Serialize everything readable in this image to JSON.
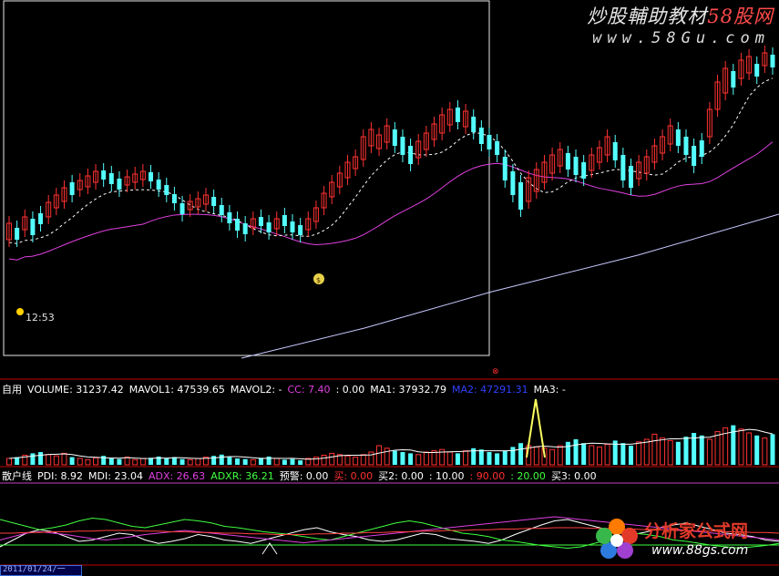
{
  "watermark": {
    "title_a": "炒股輔助教材",
    "title_b": "58股网",
    "url": "www.58Gu.com"
  },
  "logo": {
    "title": "分析家公式网",
    "url": "www.88gs.com"
  },
  "price_panel": {
    "time_label": "12:53",
    "bag_label": "$"
  },
  "volume_panel": {
    "items": [
      {
        "text": "自用",
        "color": "#ffffff"
      },
      {
        "text": "VOLUME: 31237.42",
        "color": "#ffffff"
      },
      {
        "text": "MAVOL1: 47539.65",
        "color": "#ffffff"
      },
      {
        "text": "MAVOL2: -",
        "color": "#ffffff"
      },
      {
        "text": "CC: 7.40",
        "color": "#e040e0"
      },
      {
        "text": ": 0.00",
        "color": "#ffffff"
      },
      {
        "text": "MA1: 37932.79",
        "color": "#ffffff"
      },
      {
        "text": "MA2: 47291.31",
        "color": "#3040ff"
      },
      {
        "text": "MA3: -",
        "color": "#ffffff"
      }
    ]
  },
  "indicator_panel": {
    "items": [
      {
        "text": "散户线",
        "color": "#ffffff"
      },
      {
        "text": "PDI: 8.92",
        "color": "#ffffff"
      },
      {
        "text": "MDI: 23.04",
        "color": "#ffffff"
      },
      {
        "text": "ADX: 26.63",
        "color": "#e040e0"
      },
      {
        "text": "ADXR: 36.21",
        "color": "#40ff40"
      },
      {
        "text": "预警: 0.00",
        "color": "#ffffff"
      },
      {
        "text": "买: 0.00",
        "color": "#ff3030"
      },
      {
        "text": "买2: 0.00",
        "color": "#ffffff"
      },
      {
        "text": ": 10.00",
        "color": "#ffffff"
      },
      {
        "text": ": 90.00",
        "color": "#ff3030"
      },
      {
        "text": ": 20.00",
        "color": "#40ff40"
      },
      {
        "text": "买3: 0.00",
        "color": "#ffffff"
      }
    ]
  },
  "date_label": "2011/01/24/一",
  "colors": {
    "up": "#ff3232",
    "down": "#54ffff",
    "ma_short": "#ffffff",
    "ma_mid": "#e040e0",
    "ma_long": "#c8c8ff",
    "spike": "#ffff60",
    "panel_border": "#c00000"
  },
  "chart_data": [
    {
      "type": "candlestick",
      "series": [
        {
          "name": "candles",
          "values": [
            [
              1,
              245,
              263
            ],
            [
              0,
              250,
              263
            ],
            [
              1,
              238,
              252
            ],
            [
              0,
              240,
              258
            ],
            [
              0,
              234,
              246
            ],
            [
              1,
              222,
              238
            ],
            [
              1,
              214,
              228
            ],
            [
              1,
              206,
              221
            ],
            [
              0,
              200,
              214
            ],
            [
              1,
              198,
              208
            ],
            [
              1,
              193,
              205
            ],
            [
              1,
              188,
              200
            ],
            [
              0,
              187,
              197
            ],
            [
              0,
              190,
              202
            ],
            [
              0,
              196,
              208
            ],
            [
              1,
              194,
              203
            ],
            [
              1,
              191,
              200
            ],
            [
              1,
              188,
              197
            ],
            [
              0,
              189,
              199
            ],
            [
              0,
              197,
              208
            ],
            [
              0,
              203,
              214
            ],
            [
              0,
              213,
              223
            ],
            [
              0,
              223,
              235
            ],
            [
              1,
              221,
              230
            ],
            [
              1,
              218,
              227
            ],
            [
              1,
              214,
              224
            ],
            [
              0,
              216,
              226
            ],
            [
              0,
              225,
              236
            ],
            [
              0,
              233,
              245
            ],
            [
              0,
              240,
              253
            ],
            [
              0,
              245,
              257
            ],
            [
              1,
              240,
              250
            ],
            [
              0,
              238,
              248
            ],
            [
              0,
              244,
              255
            ],
            [
              1,
              240,
              251
            ],
            [
              0,
              236,
              248
            ],
            [
              0,
              243,
              255
            ],
            [
              0,
              247,
              258
            ],
            [
              1,
              240,
              252
            ],
            [
              1,
              228,
              243
            ],
            [
              1,
              212,
              228
            ],
            [
              1,
              200,
              216
            ],
            [
              1,
              190,
              205
            ],
            [
              1,
              178,
              195
            ],
            [
              1,
              172,
              185
            ],
            [
              1,
              150,
              175
            ],
            [
              1,
              142,
              160
            ],
            [
              1,
              148,
              163
            ],
            [
              1,
              138,
              156
            ],
            [
              0,
              142,
              160
            ],
            [
              0,
              150,
              170
            ],
            [
              0,
              160,
              180
            ],
            [
              1,
              155,
              173
            ],
            [
              1,
              146,
              164
            ],
            [
              1,
              136,
              153
            ],
            [
              1,
              126,
              146
            ],
            [
              1,
              120,
              137
            ],
            [
              0,
              118,
              134
            ],
            [
              1,
              122,
              139
            ],
            [
              0,
              128,
              145
            ],
            [
              0,
              140,
              158
            ],
            [
              0,
              148,
              164
            ],
            [
              0,
              155,
              170
            ],
            [
              0,
              172,
              198
            ],
            [
              0,
              188,
              214
            ],
            [
              0,
              200,
              230
            ],
            [
              1,
              195,
              221
            ],
            [
              1,
              186,
              210
            ],
            [
              1,
              178,
              200
            ],
            [
              1,
              170,
              190
            ],
            [
              1,
              164,
              182
            ],
            [
              0,
              168,
              186
            ],
            [
              0,
              172,
              192
            ],
            [
              0,
              178,
              196
            ],
            [
              1,
              170,
              187
            ],
            [
              1,
              162,
              178
            ],
            [
              1,
              150,
              170
            ],
            [
              0,
              156,
              176
            ],
            [
              0,
              170,
              198
            ],
            [
              0,
              182,
              206
            ],
            [
              1,
              178,
              196
            ],
            [
              1,
              172,
              190
            ],
            [
              1,
              160,
              178
            ],
            [
              1,
              150,
              168
            ],
            [
              1,
              138,
              158
            ],
            [
              0,
              142,
              160
            ],
            [
              0,
              150,
              170
            ],
            [
              0,
              160,
              182
            ],
            [
              0,
              154,
              172
            ],
            [
              1,
              120,
              150
            ],
            [
              1,
              90,
              120
            ],
            [
              1,
              75,
              102
            ],
            [
              0,
              78,
              96
            ],
            [
              1,
              66,
              86
            ],
            [
              1,
              62,
              80
            ],
            [
              0,
              70,
              84
            ],
            [
              1,
              58,
              72
            ],
            [
              0,
              60,
              74
            ]
          ]
        }
      ],
      "ylim": [
        0,
        400
      ]
    },
    {
      "type": "bar",
      "series": [
        {
          "name": "VOLUME",
          "values": [
            10,
            12,
            15,
            18,
            20,
            16,
            14,
            18,
            12,
            10,
            8,
            11,
            14,
            10,
            9,
            12,
            8,
            10,
            11,
            13,
            10,
            12,
            9,
            8,
            10,
            12,
            14,
            16,
            12,
            10,
            9,
            8,
            11,
            13,
            10,
            8,
            9,
            7,
            10,
            12,
            15,
            18,
            16,
            14,
            12,
            16,
            20,
            30,
            26,
            22,
            20,
            18,
            16,
            20,
            22,
            24,
            20,
            18,
            22,
            26,
            24,
            20,
            18,
            22,
            28,
            34,
            30,
            28,
            26,
            24,
            30,
            36,
            40,
            34,
            30,
            28,
            32,
            38,
            34,
            30,
            36,
            40,
            48,
            42,
            38,
            36,
            44,
            50,
            46,
            40,
            52,
            58,
            62,
            56,
            50,
            46,
            42,
            48
          ]
        }
      ],
      "ylim": [
        0,
        100
      ]
    },
    {
      "type": "line",
      "series": [
        {
          "name": "PDI",
          "values": [
            20,
            30,
            40,
            45,
            42,
            35,
            28,
            30,
            35,
            40,
            38,
            30,
            25,
            28,
            32,
            38,
            35,
            30,
            28,
            25,
            30,
            35,
            40,
            45,
            48,
            42,
            38,
            35,
            30,
            28,
            30,
            35,
            40,
            38,
            32,
            30,
            28,
            25,
            30,
            38,
            45,
            52,
            58,
            60,
            55,
            50,
            45,
            40,
            38,
            42,
            48,
            52,
            55,
            50,
            45,
            40,
            38,
            35,
            30,
            28
          ]
        },
        {
          "name": "MDI",
          "values": [
            60,
            55,
            50,
            45,
            48,
            52,
            58,
            62,
            60,
            55,
            50,
            48,
            52,
            56,
            60,
            58,
            55,
            50,
            48,
            45,
            42,
            40,
            38,
            35,
            32,
            30,
            35,
            40,
            45,
            50,
            55,
            58,
            55,
            50,
            45,
            40,
            38,
            35,
            30,
            28,
            25,
            22,
            20,
            18,
            20,
            25,
            30,
            35,
            40,
            38,
            35,
            30,
            28,
            25,
            22,
            20,
            18,
            20,
            22,
            25
          ]
        },
        {
          "name": "ADX",
          "values": [
            30,
            35,
            40,
            42,
            40,
            38,
            35,
            32,
            30,
            32,
            35,
            38,
            40,
            42,
            44,
            42,
            40,
            38,
            36,
            34,
            32,
            30,
            28,
            26,
            28,
            30,
            32,
            34,
            36,
            38,
            40,
            42,
            44,
            46,
            48,
            50,
            52,
            54,
            56,
            58,
            60,
            62,
            64,
            62,
            60,
            58,
            56,
            54,
            52,
            50,
            48,
            46,
            44,
            42,
            40,
            38,
            36,
            34,
            32,
            30
          ]
        },
        {
          "name": "ADXR",
          "values": [
            40,
            40,
            41,
            41,
            42,
            42,
            43,
            43,
            44,
            44,
            44,
            43,
            43,
            42,
            42,
            41,
            41,
            40,
            40,
            39,
            39,
            38,
            38,
            38,
            39,
            39,
            40,
            40,
            41,
            41,
            42,
            42,
            43,
            43,
            44,
            44,
            45,
            45,
            46,
            46,
            47,
            47,
            48,
            48,
            48,
            47,
            47,
            46,
            46,
            45,
            45,
            44,
            44,
            43,
            43,
            42,
            42,
            41,
            41,
            40
          ]
        }
      ],
      "ylim": [
        0,
        100
      ]
    }
  ]
}
